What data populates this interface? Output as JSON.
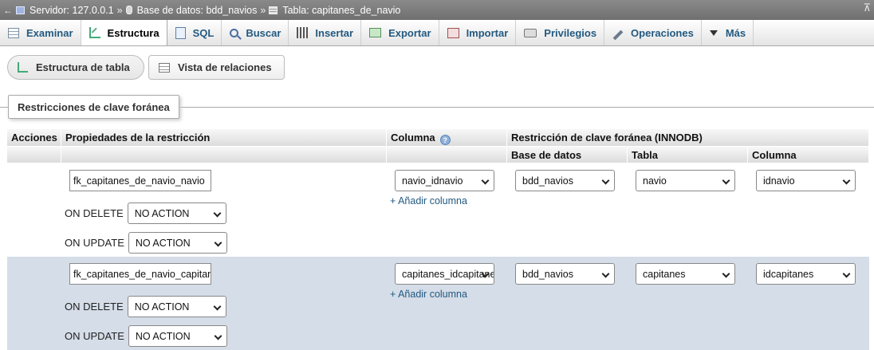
{
  "breadcrumb": {
    "back": "←",
    "server_label": "Servidor: 127.0.0.1",
    "database_label": "Base de datos: bdd_navios",
    "table_label": "Tabla: capitanes_de_navio",
    "separator": "»",
    "close_glyph": "⊼"
  },
  "tabs": [
    {
      "label": "Examinar",
      "icon": "browse-icon"
    },
    {
      "label": "Estructura",
      "icon": "structure-icon",
      "active": true
    },
    {
      "label": "SQL",
      "icon": "sql-icon"
    },
    {
      "label": "Buscar",
      "icon": "search-icon"
    },
    {
      "label": "Insertar",
      "icon": "insert-icon"
    },
    {
      "label": "Exportar",
      "icon": "export-icon"
    },
    {
      "label": "Importar",
      "icon": "import-icon"
    },
    {
      "label": "Privilegios",
      "icon": "privileges-icon"
    },
    {
      "label": "Operaciones",
      "icon": "operations-icon"
    },
    {
      "label": "Más",
      "icon": "more-icon"
    }
  ],
  "subnav": {
    "table_structure": "Estructura de tabla",
    "relation_view": "Vista de relaciones"
  },
  "section": {
    "legend": "Restricciones de clave foránea"
  },
  "table_header": {
    "actions": "Acciones",
    "properties": "Propiedades de la restricción",
    "column": "Columna",
    "fk_constraint": "Restricción de clave foránea (INNODB)",
    "database": "Base de datos",
    "table": "Tabla",
    "ref_column": "Columna"
  },
  "constraints": [
    {
      "name": "fk_capitanes_de_navio_navio",
      "on_delete_label": "ON DELETE",
      "on_delete": "NO ACTION",
      "on_update_label": "ON UPDATE",
      "on_update": "NO ACTION",
      "column": "navio_idnavio",
      "add_column": "+ Añadir columna",
      "database": "bdd_navios",
      "table": "navio",
      "ref_column": "idnavio"
    },
    {
      "name": "fk_capitanes_de_navio_capitanes",
      "on_delete_label": "ON DELETE",
      "on_delete": "NO ACTION",
      "on_update_label": "ON UPDATE",
      "on_update": "NO ACTION",
      "column": "capitanes_idcapitanes",
      "add_column": "+ Añadir columna",
      "database": "bdd_navios",
      "table": "capitanes",
      "ref_column": "idcapitanes"
    }
  ],
  "colors": {
    "topbar": "#777777",
    "link": "#235a81",
    "row_alt": "#d5dde8"
  }
}
